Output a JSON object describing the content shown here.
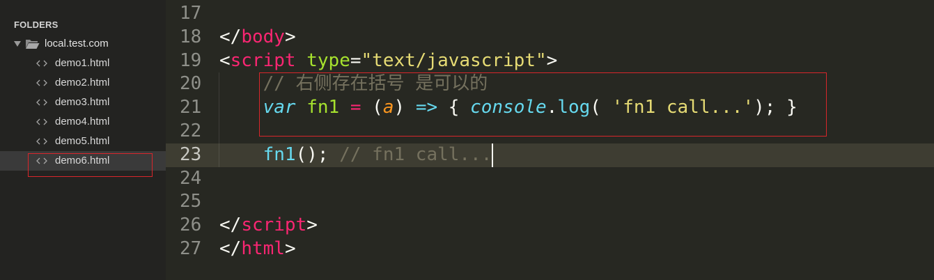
{
  "theme": {
    "sidebar_bg": "#232321",
    "editor_bg": "#272822",
    "selected_row_bg": "#3a3a3a",
    "current_line_bg": "#3e3d32",
    "gutter_fg": "#8f908a",
    "annotation": "#d9262b"
  },
  "sidebar": {
    "header": "FOLDERS",
    "folder": {
      "name": "local.test.com",
      "icon": "folder-open-icon",
      "expand_icon": "triangle-down-icon"
    },
    "selected_index": 5,
    "files": [
      {
        "name": "demo1.html",
        "icon": "file-code-icon"
      },
      {
        "name": "demo2.html",
        "icon": "file-code-icon"
      },
      {
        "name": "demo3.html",
        "icon": "file-code-icon"
      },
      {
        "name": "demo4.html",
        "icon": "file-code-icon"
      },
      {
        "name": "demo5.html",
        "icon": "file-code-icon"
      },
      {
        "name": "demo6.html",
        "icon": "file-code-icon"
      }
    ]
  },
  "editor": {
    "current_line": 23,
    "lines": [
      {
        "number": "17",
        "tokens": []
      },
      {
        "number": "18",
        "tokens": [
          {
            "v": "</",
            "color": "#f8f8f2"
          },
          {
            "v": "body",
            "color": "#f92672"
          },
          {
            "v": ">",
            "color": "#f8f8f2"
          }
        ]
      },
      {
        "number": "19",
        "tokens": [
          {
            "v": "<",
            "color": "#f8f8f2"
          },
          {
            "v": "script",
            "color": "#f92672"
          },
          {
            "v": " ",
            "color": "#f8f8f2"
          },
          {
            "v": "type",
            "color": "#a6e22e"
          },
          {
            "v": "=",
            "color": "#f8f8f2"
          },
          {
            "v": "\"text/javascript\"",
            "color": "#e6db74"
          },
          {
            "v": ">",
            "color": "#f8f8f2"
          }
        ]
      },
      {
        "number": "20",
        "tokens": [
          {
            "v": "    ",
            "color": "#f8f8f2"
          },
          {
            "v": "// 右侧存在括号 是可以的",
            "color": "#75715e"
          }
        ]
      },
      {
        "number": "21",
        "tokens": [
          {
            "v": "    ",
            "color": "#f8f8f2"
          },
          {
            "v": "var",
            "color": "#66d9ef",
            "italic": true
          },
          {
            "v": " ",
            "color": "#f8f8f2"
          },
          {
            "v": "fn1",
            "color": "#a6e22e"
          },
          {
            "v": " ",
            "color": "#f8f8f2"
          },
          {
            "v": "=",
            "color": "#f92672"
          },
          {
            "v": " (",
            "color": "#f8f8f2"
          },
          {
            "v": "a",
            "color": "#fd971f",
            "italic": true
          },
          {
            "v": ") ",
            "color": "#f8f8f2"
          },
          {
            "v": "=>",
            "color": "#66d9ef"
          },
          {
            "v": " { ",
            "color": "#f8f8f2"
          },
          {
            "v": "console",
            "color": "#66d9ef",
            "italic": true
          },
          {
            "v": ".",
            "color": "#f8f8f2"
          },
          {
            "v": "log",
            "color": "#66d9ef"
          },
          {
            "v": "( ",
            "color": "#f8f8f2"
          },
          {
            "v": "'fn1 call...'",
            "color": "#e6db74"
          },
          {
            "v": "); }",
            "color": "#f8f8f2"
          }
        ]
      },
      {
        "number": "22",
        "tokens": []
      },
      {
        "number": "23",
        "tokens": [
          {
            "v": "    ",
            "color": "#f8f8f2"
          },
          {
            "v": "fn1",
            "color": "#66d9ef"
          },
          {
            "v": "();",
            "color": "#f8f8f2"
          },
          {
            "v": " ",
            "color": "#f8f8f2"
          },
          {
            "v": "// fn1 call...",
            "color": "#75715e"
          }
        ]
      },
      {
        "number": "24",
        "tokens": []
      },
      {
        "number": "25",
        "tokens": []
      },
      {
        "number": "26",
        "tokens": [
          {
            "v": "</",
            "color": "#f8f8f2"
          },
          {
            "v": "script",
            "color": "#f92672"
          },
          {
            "v": ">",
            "color": "#f8f8f2"
          }
        ]
      },
      {
        "number": "27",
        "tokens": [
          {
            "v": "</",
            "color": "#f8f8f2"
          },
          {
            "v": "html",
            "color": "#f92672"
          },
          {
            "v": ">",
            "color": "#f8f8f2"
          }
        ]
      }
    ]
  }
}
